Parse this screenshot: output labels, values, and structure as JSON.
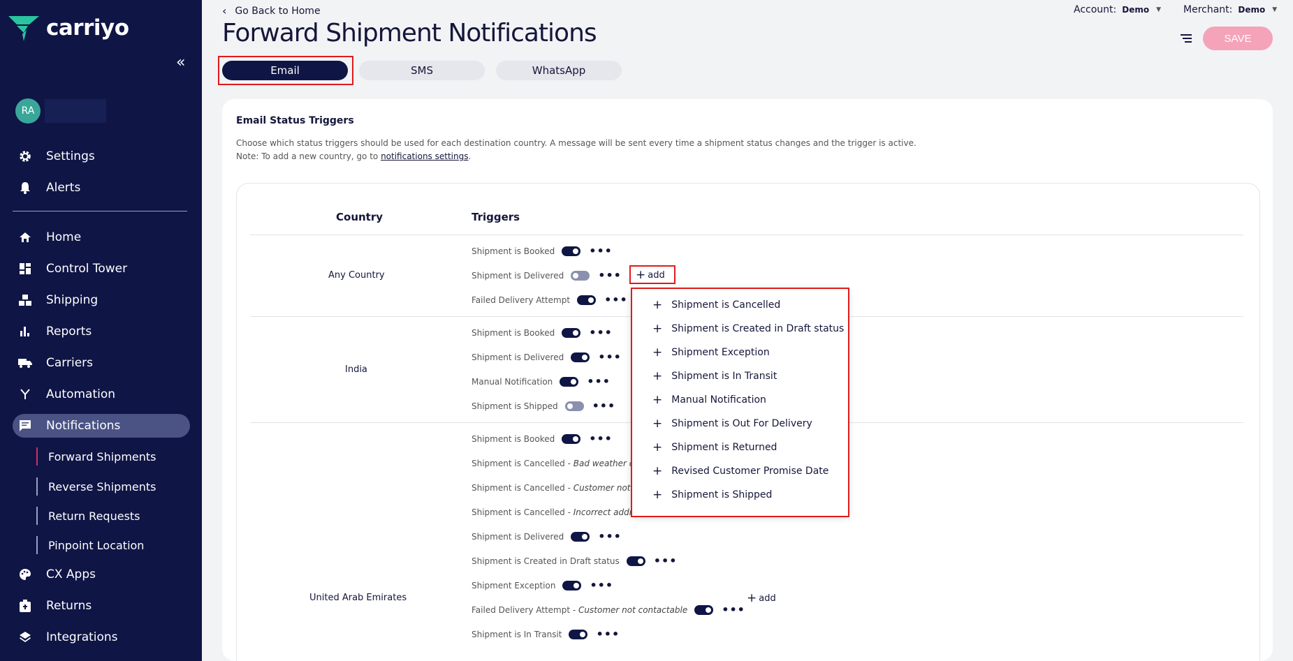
{
  "brand": {
    "name": "carriyo"
  },
  "user": {
    "initials": "RA"
  },
  "sidebar": {
    "top_items": [
      {
        "label": "Settings",
        "icon": "gear-icon"
      },
      {
        "label": "Alerts",
        "icon": "bell-icon"
      }
    ],
    "items": [
      {
        "label": "Home",
        "icon": "home-icon"
      },
      {
        "label": "Control Tower",
        "icon": "dashboard-icon"
      },
      {
        "label": "Shipping",
        "icon": "boxes-icon"
      },
      {
        "label": "Reports",
        "icon": "bar-chart-icon"
      },
      {
        "label": "Carriers",
        "icon": "truck-icon"
      },
      {
        "label": "Automation",
        "icon": "branch-icon"
      },
      {
        "label": "Notifications",
        "icon": "chat-icon"
      }
    ],
    "sub_items": [
      {
        "label": "Forward Shipments"
      },
      {
        "label": "Reverse Shipments"
      },
      {
        "label": "Return Requests"
      },
      {
        "label": "Pinpoint Location"
      }
    ],
    "bottom_items": [
      {
        "label": "CX Apps",
        "icon": "palette-icon"
      },
      {
        "label": "Returns",
        "icon": "return-box-icon"
      },
      {
        "label": "Integrations",
        "icon": "layers-icon"
      }
    ]
  },
  "header": {
    "back_label": "Go Back to Home",
    "title": "Forward Shipment Notifications",
    "account_label": "Account:",
    "account_value": "Demo",
    "merchant_label": "Merchant:",
    "merchant_value": "Demo",
    "save_label": "SAVE"
  },
  "tabs": [
    {
      "label": "Email"
    },
    {
      "label": "SMS"
    },
    {
      "label": "WhatsApp"
    }
  ],
  "card": {
    "title": "Email Status Triggers",
    "description": "Choose which status triggers should be used for each destination country. A message will be sent every time a shipment status changes and the trigger is active.",
    "note_prefix": "Note: To add a new country, go to ",
    "note_link": "notifications settings",
    "note_suffix": "."
  },
  "table": {
    "col_country": "Country",
    "col_triggers": "Triggers",
    "add_label": "add",
    "groups": [
      {
        "country": "Any Country",
        "triggers": [
          {
            "label": "Shipment is Booked",
            "reason": "",
            "enabled": true
          },
          {
            "label": "Shipment is Delivered",
            "reason": "",
            "enabled": false
          },
          {
            "label": "Failed Delivery Attempt",
            "reason": "",
            "enabled": true
          }
        ]
      },
      {
        "country": "India",
        "triggers": [
          {
            "label": "Shipment is Booked",
            "reason": "",
            "enabled": true
          },
          {
            "label": "Shipment is Delivered",
            "reason": "",
            "enabled": true
          },
          {
            "label": "Manual Notification",
            "reason": "",
            "enabled": true
          },
          {
            "label": "Shipment is Shipped",
            "reason": "",
            "enabled": false
          }
        ]
      },
      {
        "country": "United Arab Emirates",
        "triggers": [
          {
            "label": "Shipment is Booked",
            "reason": "",
            "enabled": true
          },
          {
            "label": "Shipment is Cancelled",
            "reason": "Bad weather co",
            "enabled": null
          },
          {
            "label": "Shipment is Cancelled",
            "reason": "Customer not c",
            "enabled": null
          },
          {
            "label": "Shipment is Cancelled",
            "reason": "Incorrect addres",
            "enabled": null
          },
          {
            "label": "Shipment is Delivered",
            "reason": "",
            "enabled": true
          },
          {
            "label": "Shipment is Created in Draft status",
            "reason": "",
            "enabled": true
          },
          {
            "label": "Shipment Exception",
            "reason": "",
            "enabled": true
          },
          {
            "label": "Failed Delivery Attempt",
            "reason": "Customer not contactable",
            "enabled": true
          },
          {
            "label": "Shipment is In Transit",
            "reason": "",
            "enabled": true
          }
        ]
      }
    ]
  },
  "dropdown": {
    "items": [
      "Shipment is Cancelled",
      "Shipment is Created in Draft status",
      "Shipment Exception",
      "Shipment is In Transit",
      "Manual Notification",
      "Shipment is Out For Delivery",
      "Shipment is Returned",
      "Revised Customer Promise Date",
      "Shipment is Shipped"
    ]
  },
  "colors": {
    "sidebar_bg": "#0f1545",
    "accent": "#0f1545",
    "save_disabled": "#f4a3b9",
    "highlight_box": "#e01b1b"
  }
}
